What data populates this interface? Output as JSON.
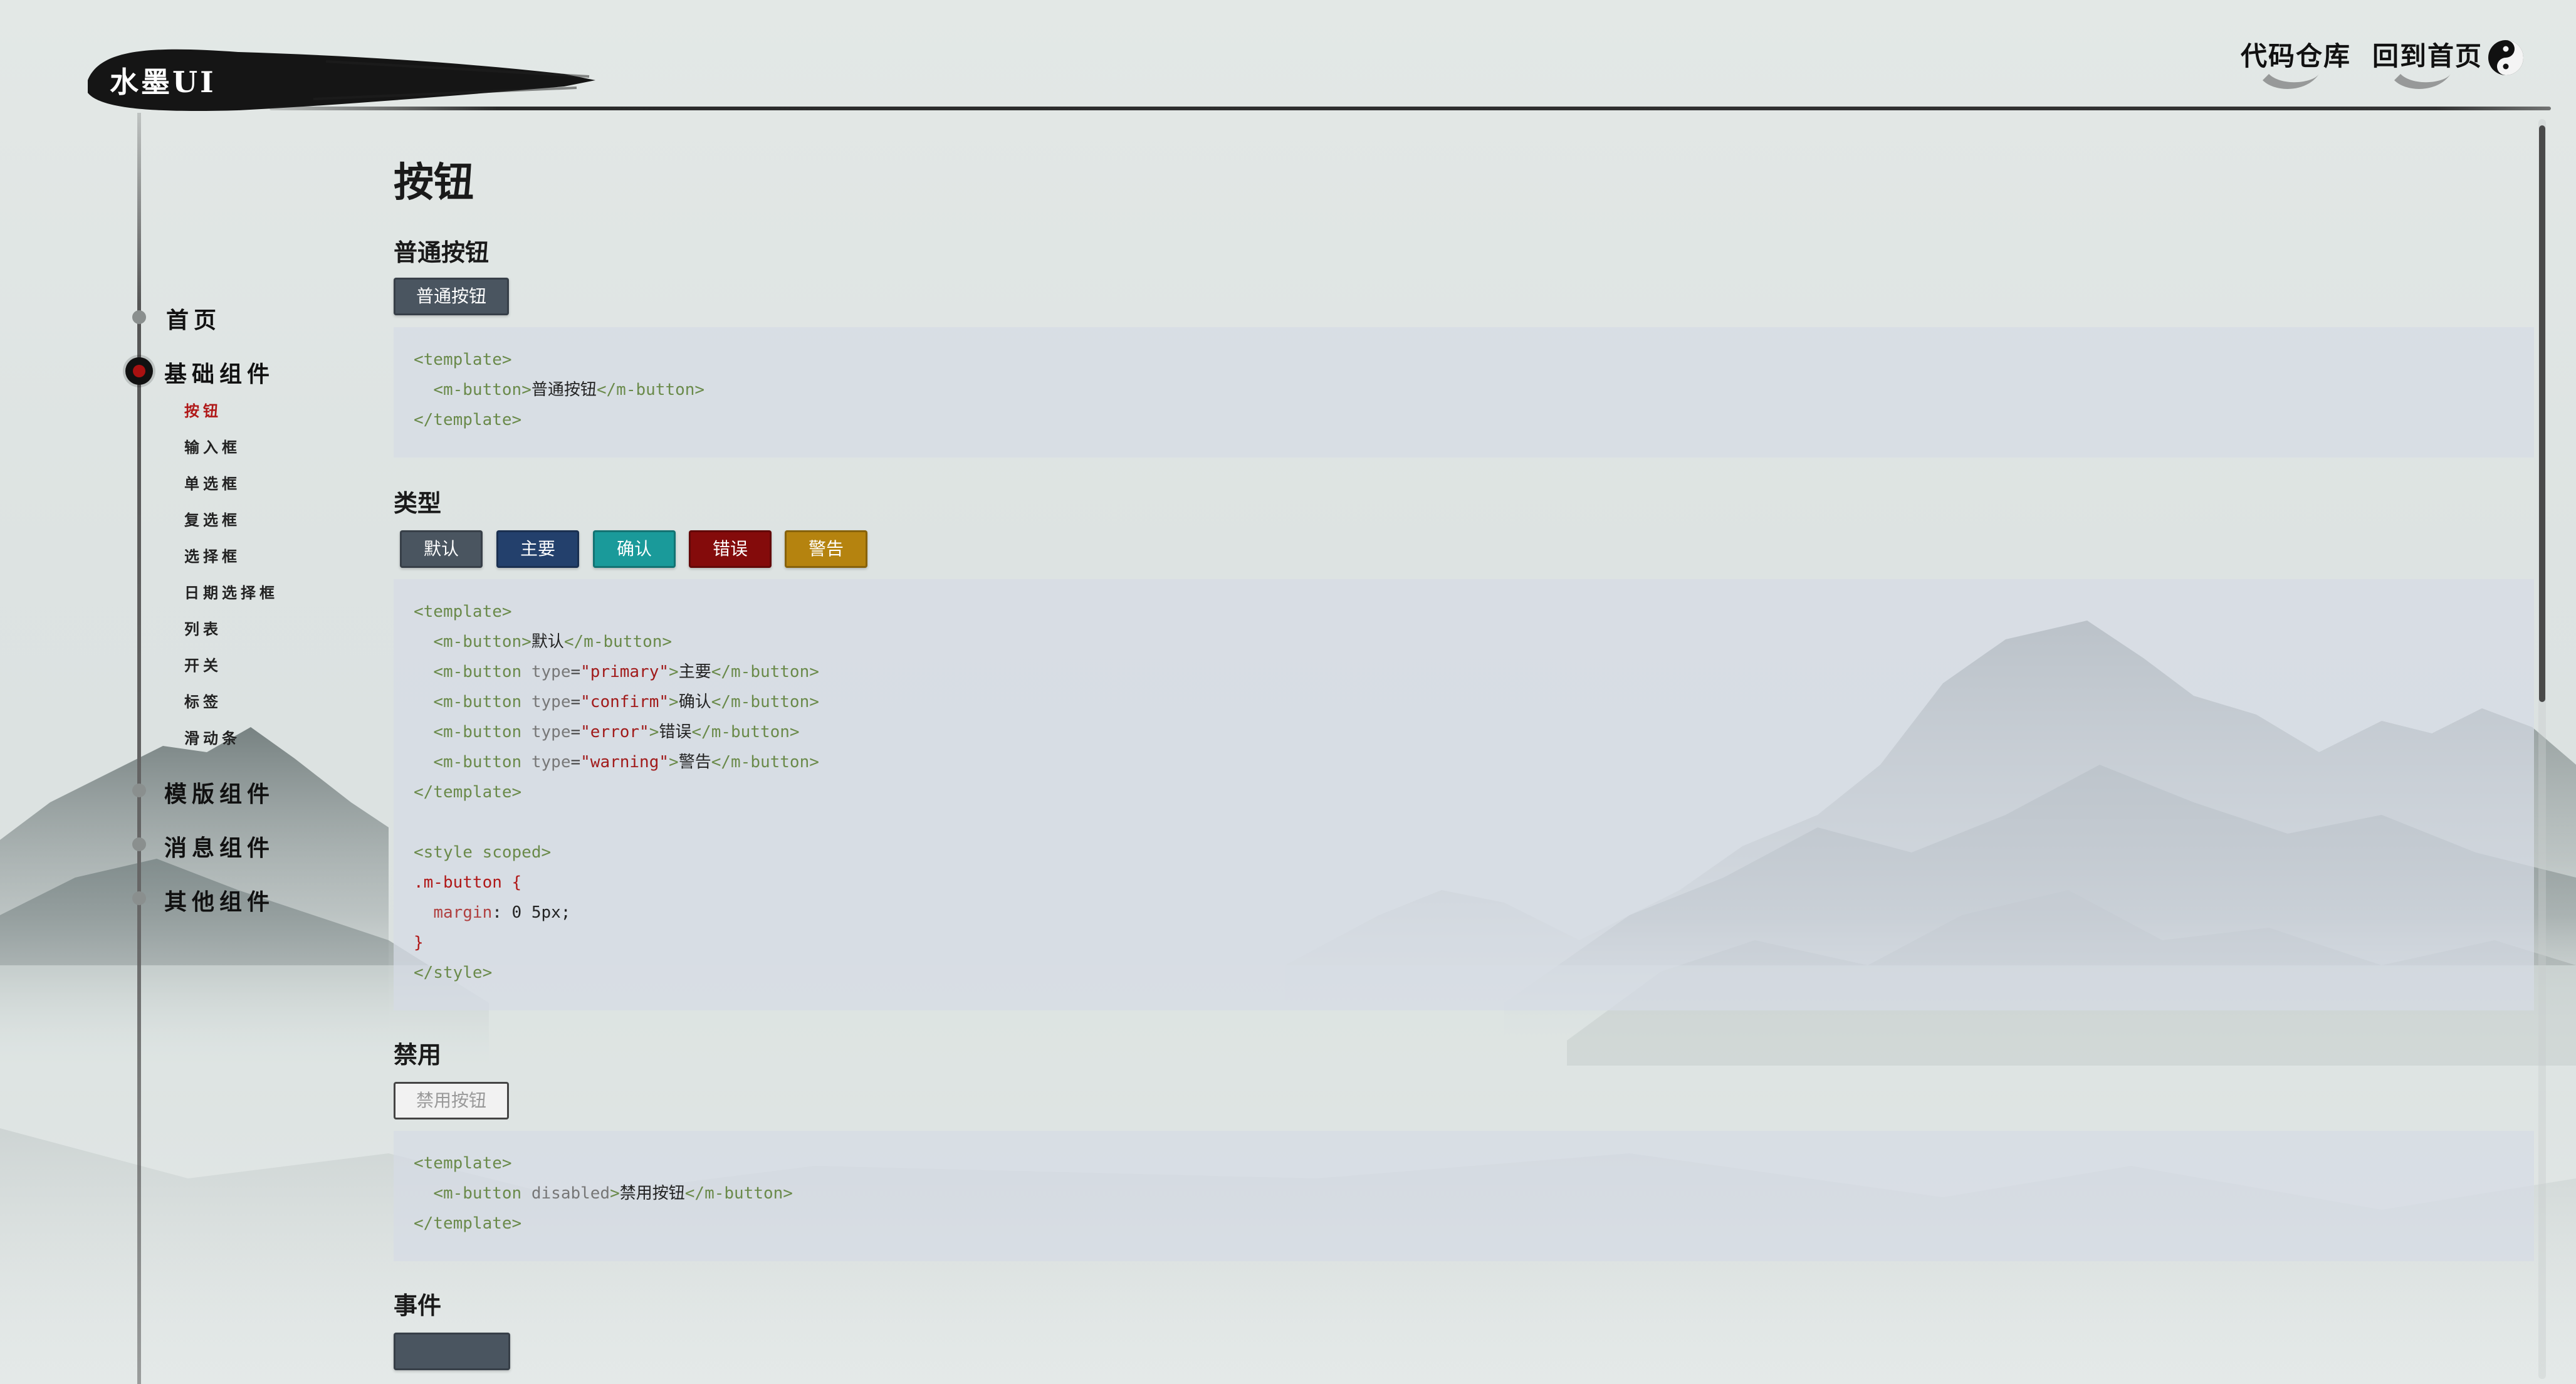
{
  "header": {
    "logo": "水墨UI",
    "nav": [
      "代码仓库",
      "回到首页"
    ]
  },
  "sidebar": {
    "groups": [
      {
        "label": "首页"
      },
      {
        "label": "基础组件"
      },
      {
        "label": "模版组件"
      },
      {
        "label": "消息组件"
      },
      {
        "label": "其他组件"
      }
    ],
    "items": [
      {
        "label": "按钮"
      },
      {
        "label": "输入框"
      },
      {
        "label": "单选框"
      },
      {
        "label": "复选框"
      },
      {
        "label": "选择框"
      },
      {
        "label": "日期选择框"
      },
      {
        "label": "列表"
      },
      {
        "label": "开关"
      },
      {
        "label": "标签"
      },
      {
        "label": "滑动条"
      }
    ]
  },
  "main": {
    "title": "按钮",
    "sections": [
      {
        "title": "普通按钮"
      },
      {
        "title": "类型"
      },
      {
        "title": "禁用"
      },
      {
        "title": "事件"
      }
    ],
    "normal_button": "普通按钮",
    "type_buttons": [
      "默认",
      "主要",
      "确认",
      "错误",
      "警告"
    ],
    "disabled_button": "禁用按钮",
    "code_normal": {
      "open": "<template>",
      "tag_open": "<m-button>",
      "text": "普通按钮",
      "tag_close": "</m-button>",
      "close": "</template>"
    },
    "code_types": {
      "open": "<template>",
      "lines": [
        {
          "attr": "",
          "val": "",
          "text": "默认"
        },
        {
          "attr": "type",
          "val": "\"primary\"",
          "text": "主要"
        },
        {
          "attr": "type",
          "val": "\"confirm\"",
          "text": "确认"
        },
        {
          "attr": "type",
          "val": "\"error\"",
          "text": "错误"
        },
        {
          "attr": "type",
          "val": "\"warning\"",
          "text": "警告"
        }
      ],
      "close": "</template>",
      "style_open": "<style scoped>",
      "selector": ".m-button {",
      "prop": "margin",
      "value": ": 0 5px;",
      "brace": "}",
      "style_close": "</style>"
    },
    "code_disabled": {
      "open": "<template>",
      "attr": "disabled",
      "text": "禁用按钮",
      "close": "</template>"
    }
  },
  "colors": {
    "default": "#4a5560",
    "primary": "#23406c",
    "confirm": "#1a9a9a",
    "error": "#840b0b",
    "warning": "#b5830f",
    "active_nav": "#b01818"
  }
}
